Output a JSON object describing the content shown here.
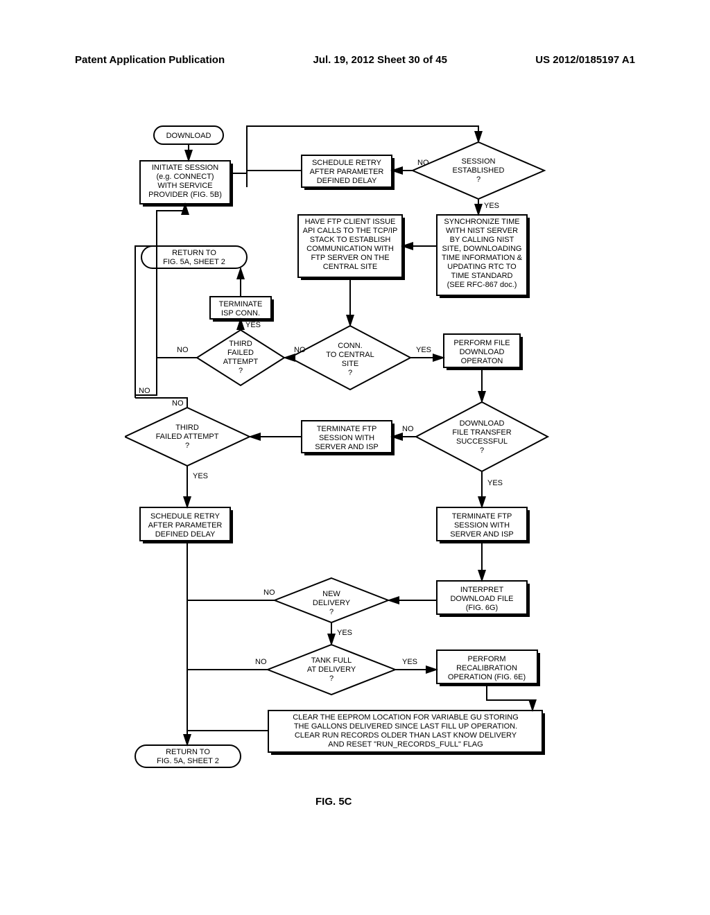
{
  "header": {
    "left": "Patent Application Publication",
    "center": "Jul. 19, 2012  Sheet 30 of 45",
    "right": "US 2012/0185197 A1"
  },
  "figure_label": "FIG. 5C",
  "nodes": {
    "download": "DOWNLOAD",
    "initiate": "INITIATE SESSION (e.g. CONNECT) WITH SERVICE PROVIDER (FIG. 5B)",
    "schedule_retry_top": "SCHEDULE RETRY AFTER PARAMETER DEFINED DELAY",
    "session_established": "SESSION ESTABLISHED ?",
    "synchronize": "SYNCHRONIZE TIME WITH NIST SERVER BY CALLING NIST SITE, DOWNLOADING TIME INFORMATION & UPDATING RTC TO TIME STANDARD (SEE RFC-867 doc.)",
    "ftp_client": "HAVE FTP CLIENT ISSUE API CALLS TO THE TCP/IP STACK TO ESTABLISH COMMUNICATION WITH FTP SERVER ON THE CENTRAL SITE",
    "return_to_5a_top": "RETURN TO FIG. 5A, SHEET 2",
    "terminate_isp": "TERMINATE ISP CONN.",
    "third_failed_small": "THIRD FAILED ATTEMPT ?",
    "conn_central": "CONN. TO CENTRAL SITE ?",
    "perform_download": "PERFORM FILE DOWNLOAD OPERATON",
    "third_failed": "THIRD FAILED ATTEMPT ?",
    "terminate_ftp_isp": "TERMINATE FTP SESSION WITH SERVER AND ISP",
    "download_success": "DOWNLOAD FILE TRANSFER SUCCESSFUL ?",
    "schedule_retry_bot": "SCHEDULE RETRY AFTER PARAMETER DEFINED DELAY",
    "terminate_ftp_isp2": "TERMINATE FTP SESSION WITH SERVER AND ISP",
    "new_delivery": "NEW DELIVERY ?",
    "interpret": "INTERPRET DOWNLOAD FILE (FIG. 6G)",
    "tank_full": "TANK FULL AT DELIVERY ?",
    "perform_recal": "PERFORM RECALIBRATION OPERATION (FIG. 6E)",
    "clear_eeprom": "CLEAR THE EEPROM LOCATION FOR VARIABLE GU STORING THE GALLONS DELIVERED SINCE LAST FILL UP OPERATION. CLEAR RUN RECORDS OLDER THAN LAST KNOW DELIVERY AND RESET \"RUN_RECORDS_FULL\" FLAG",
    "return_to_5a_bot": "RETURN TO FIG. 5A, SHEET 2"
  },
  "labels": {
    "yes": "YES",
    "no": "NO"
  }
}
